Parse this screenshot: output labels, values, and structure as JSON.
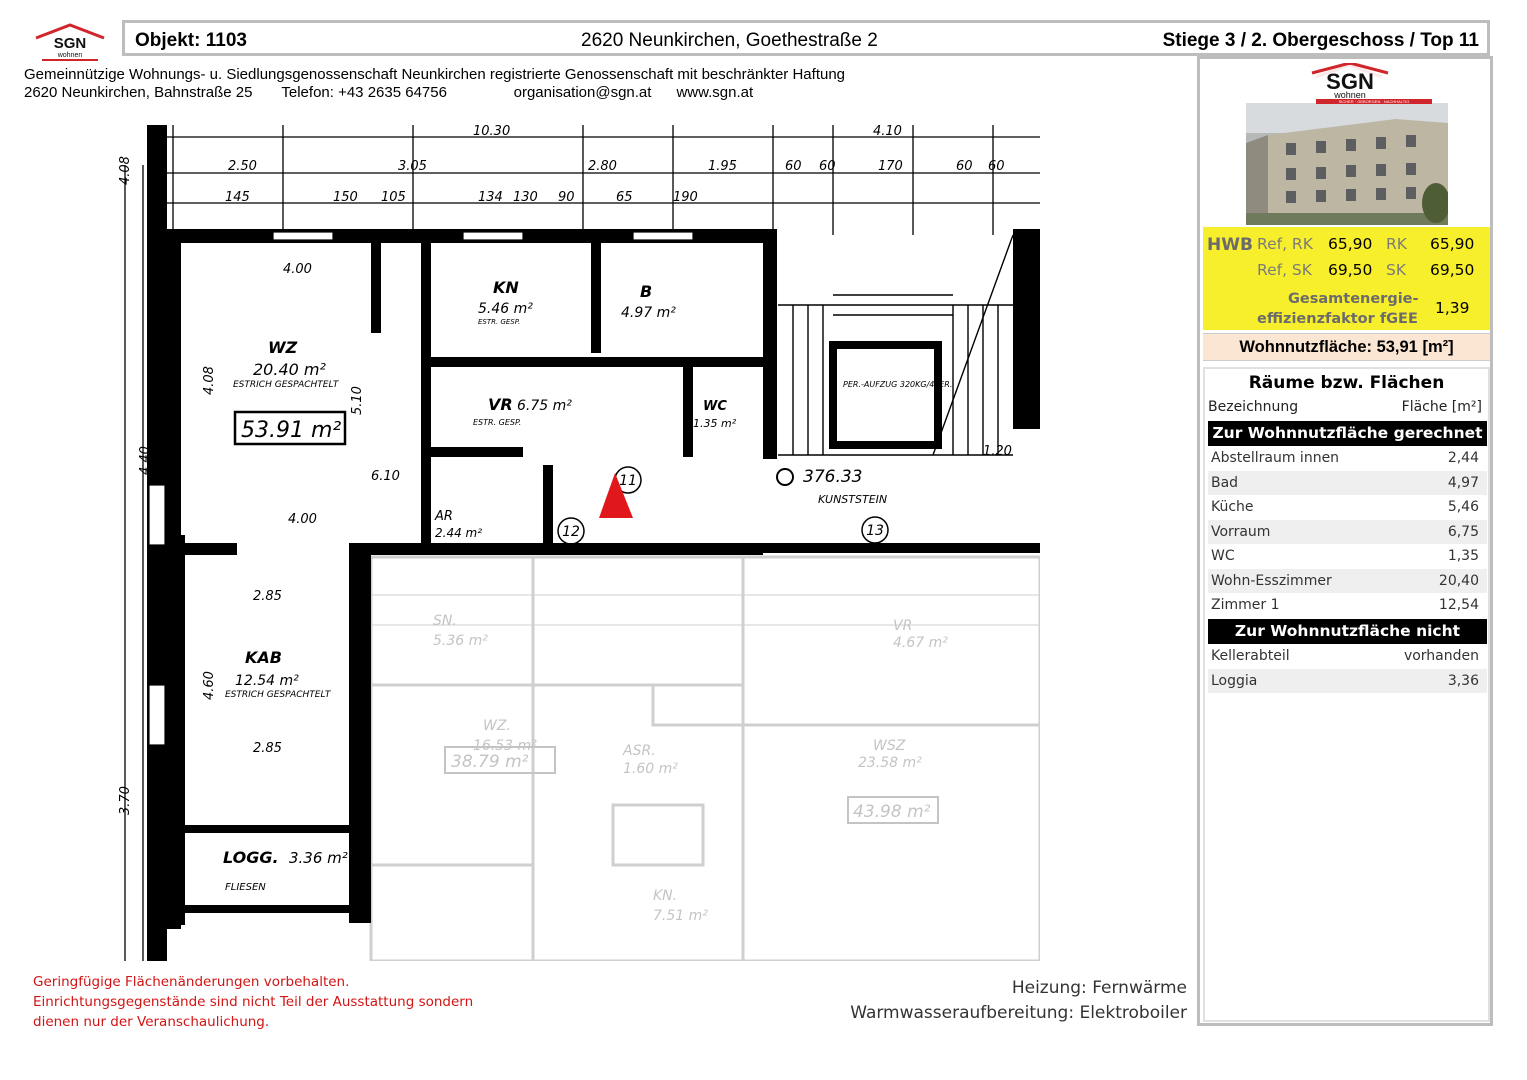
{
  "header": {
    "objekt": "Objekt:  1103",
    "adresse": "2620 Neunkirchen, Goethestraße 2",
    "lage": "Stiege 3 / 2. Obergeschoss / Top 11"
  },
  "logo": {
    "text": "SGN",
    "sub": "wohnen",
    "tagline": "SICHER · GEBORGEN · NACHHALTIG"
  },
  "organisation": {
    "line1": "Gemeinnützige Wohnungs- u. Siedlungsgenossenschaft Neunkirchen registrierte Genossenschaft mit beschränkter Haftung",
    "line2": "2620 Neunkirchen, Bahnstraße 25       Telefon: +43 2635 64756                organisation@sgn.at      www.sgn.at"
  },
  "plan": {
    "dims_top": [
      "10.30",
      "4.10",
      "2.50",
      "3.05",
      "2.80",
      "1.95",
      "60",
      "60",
      "170",
      "60",
      "60"
    ],
    "dims_sub": [
      "145",
      "150",
      "105",
      "134",
      "130",
      "90",
      "65",
      "190"
    ],
    "rooms": [
      {
        "name": "WZ",
        "area": "20.40 m²",
        "note": "ESTRICH GESPACHTELT"
      },
      {
        "name": "KN",
        "area": "5.46 m²",
        "note": "ESTR. GESP."
      },
      {
        "name": "B",
        "area": "4.97 m²"
      },
      {
        "name": "VR",
        "area": "6.75 m²",
        "note": "ESTR. GESP."
      },
      {
        "name": "WC",
        "area": "1.35 m²"
      },
      {
        "name": "AR",
        "area": "2.44 m²"
      },
      {
        "name": "KAB",
        "area": "12.54 m²",
        "note": "ESTRICH GESPACHTELT"
      },
      {
        "name": "LOGG.",
        "area": "3.36 m²",
        "note": "FLIESEN"
      }
    ],
    "total_box": "53.91 m²",
    "stair_labels": [
      "11",
      "12",
      "13"
    ],
    "level": "376.33",
    "kunststein": "KUNSTSTEIN",
    "aufzug": "PER.-AUFZUG 320KG/4PER.",
    "ghost_rooms": [
      {
        "name": "SN.",
        "area": "5.36 m²"
      },
      {
        "name": "WZ.",
        "area": "16.53 m²"
      },
      {
        "name": "VR",
        "area": "4.67 m²"
      },
      {
        "name": "WSZ",
        "area": "23.58 m²"
      },
      {
        "name": "KN.",
        "area": "7.51 m²"
      },
      {
        "name": "ASR.",
        "area": "1.60 m²"
      }
    ],
    "ghost_totals": [
      "38.79 m²",
      "43.98 m²"
    ],
    "dims_side": [
      "4.08",
      "4.40",
      "4.60",
      "3.70",
      "4.08",
      "5.10",
      "6.10",
      "4.00",
      "2.85",
      "2.85",
      "4.00",
      "1.20"
    ]
  },
  "hwb": {
    "label": "HWB",
    "rows": [
      {
        "k1": "Ref, RK",
        "v1": "65,90",
        "k2": "RK",
        "v2": "65,90"
      },
      {
        "k1": "Ref, SK",
        "v1": "69,50",
        "k2": "SK",
        "v2": "69,50"
      }
    ],
    "fgee_label_1": "Gesamtenergie-",
    "fgee_label_2": "effizienzfaktor fGEE",
    "fgee_value": "1,39"
  },
  "wohnnutzflaeche": "Wohnnutzfläche: 53,91 [m²]",
  "rooms_table": {
    "title": "Räume bzw. Flächen",
    "col_name": "Bezeichnung",
    "col_area": "Fläche [m²]",
    "section_included": "Zur Wohnnutzfläche gerechnet",
    "included": [
      {
        "name": "Abstellraum innen",
        "area": "2,44"
      },
      {
        "name": "Bad",
        "area": "4,97"
      },
      {
        "name": "Küche",
        "area": "5,46"
      },
      {
        "name": "Vorraum",
        "area": "6,75"
      },
      {
        "name": "WC",
        "area": "1,35"
      },
      {
        "name": "Wohn-Esszimmer",
        "area": "20,40"
      },
      {
        "name": "Zimmer 1",
        "area": "12,54"
      }
    ],
    "section_excluded": "Zur Wohnnutzfläche nicht gerechnet",
    "excluded": [
      {
        "name": "Kellerabteil",
        "area": "vorhanden"
      },
      {
        "name": "Loggia",
        "area": "3,36"
      }
    ]
  },
  "notes": {
    "line1": "Geringfügige Flächenänderungen vorbehalten.",
    "line2": "Einrichtungsgegenstände sind nicht Teil der Ausstattung sondern",
    "line3": "dienen nur der Veranschaulichung."
  },
  "heizung": "Heizung: Fernwärme",
  "warmwasser": "Warmwasseraufbereitung: Elektroboiler",
  "colors": {
    "hwb_bg": "#f7ef2b",
    "wnf_bg": "#fbe5d3",
    "note_red": "#d21414",
    "logo_red": "#d0262b",
    "border_grey": "#bdbdbd"
  }
}
